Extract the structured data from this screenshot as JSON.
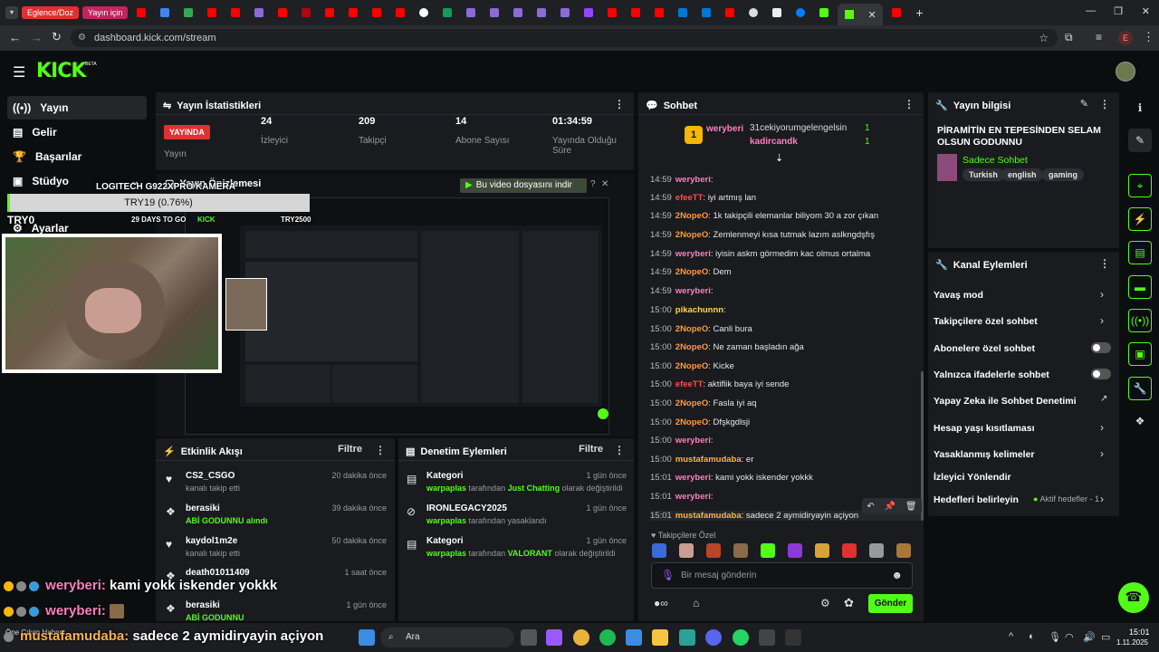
{
  "browser": {
    "tab_chip1": "Eglence/Doz",
    "tab_chip2": "Yayın için",
    "url": "dashboard.kick.com/stream"
  },
  "nav": {
    "items": [
      "Yayın",
      "Gelir",
      "Başarılar",
      "Stüdyo",
      "Ayarlar"
    ]
  },
  "overlay": {
    "camera": "LOGITECH G922XPRO KAMERA",
    "goal": "TRY19 (0.76%)",
    "try_left": "TRY0",
    "days": "29 DAYS TO GO",
    "kick": "KICK",
    "try_right": "TRY2500",
    "chat1_name": "weryberi:",
    "chat1_msg": "kami yokk iskender yokkk",
    "chat2_name": "weryberi:",
    "chat3_name": "mustafamudaba:",
    "chat3_msg": "sadece 2 aymidiryayin açiyon",
    "notice": "Öne Çıkan Haber"
  },
  "stats": {
    "title": "Yayın İstatistikleri",
    "live_badge": "YAYINDA",
    "live_label": "Yayın",
    "viewers": "24",
    "viewers_label": "İzleyici",
    "followers": "209",
    "followers_label": "Takipçi",
    "subs": "14",
    "subs_label": "Abone Sayısı",
    "uptime": "01:34:59",
    "uptime_label": "Yayında Olduğu Süre"
  },
  "preview": {
    "title": "Yayın Önizlemesi",
    "tooltip": "Bu video dosyasını indir"
  },
  "activity": {
    "title": "Etkinlik Akışı",
    "filter": "Filtre",
    "items": [
      {
        "name": "CS2_CSGO",
        "sub": "kanalı takip etti",
        "time": "20 dakika önce"
      },
      {
        "name": "berasiki",
        "sub": "ABİ GODUNNU alındı",
        "time": "39 dakika önce"
      },
      {
        "name": "kaydol1m2e",
        "sub": "kanalı takip etti",
        "time": "50 dakika önce"
      },
      {
        "name": "death01011409",
        "sub": "",
        "time": "1 saat önce"
      },
      {
        "name": "berasiki",
        "sub": "ABİ GODUNNU",
        "time": "1 gün önce"
      }
    ]
  },
  "moderation": {
    "title": "Denetim Eylemleri",
    "filter": "Filtre",
    "items": [
      {
        "name": "Kategori",
        "user": "warpaplas",
        "mid": "tarafından",
        "val": "Just Chatting",
        "end": "olarak değiştirildi",
        "time": "1 gün önce"
      },
      {
        "name": "IRONLEGACY2025",
        "user": "warpaplas",
        "mid": "tarafından yasaklandı",
        "val": "",
        "end": "",
        "time": "1 gün önce"
      },
      {
        "name": "Kategori",
        "user": "warpaplas",
        "mid": "tarafından",
        "val": "VALORANT",
        "end": "olarak değiştirildi",
        "time": "1 gün önce"
      }
    ]
  },
  "chat": {
    "title": "Sohbet",
    "top_gifter": "weryberi",
    "gifter_count": "1",
    "g2": "31cekiyorumgelengelsin",
    "g2_count": "1",
    "g3": "kadircandk",
    "g3_count": "1",
    "lines": [
      {
        "t": "14:59",
        "u": "weryberi",
        "m": "",
        "c": "#ff7fbf"
      },
      {
        "t": "14:59",
        "u": "efeeTT",
        "m": "iyi artmış lan",
        "c": "#ff4d4d"
      },
      {
        "t": "14:59",
        "u": "2NopeO",
        "m": "1k takipçili elemanlar biliyom 30 a zor çıkan",
        "c": "#ff9b3d"
      },
      {
        "t": "14:59",
        "u": "2NopeO",
        "m": "Zemlenmeyi kısa tutmak lazım aslkngdşfış",
        "c": "#ff9b3d"
      },
      {
        "t": "14:59",
        "u": "weryberi",
        "m": "iyisin askm görmedim kac olmus ortalma",
        "c": "#ff7fbf"
      },
      {
        "t": "14:59",
        "u": "2NopeO",
        "m": "Dem",
        "c": "#ff9b3d"
      },
      {
        "t": "14:59",
        "u": "weryberi",
        "m": "",
        "c": "#ff7fbf"
      },
      {
        "t": "15:00",
        "u": "pikachunnn",
        "m": "",
        "c": "#ffd54a"
      },
      {
        "t": "15:00",
        "u": "2NopeO",
        "m": "Canli bura",
        "c": "#ff9b3d"
      },
      {
        "t": "15:00",
        "u": "2NopeO",
        "m": "Ne zaman başladın ağa",
        "c": "#ff9b3d"
      },
      {
        "t": "15:00",
        "u": "2NopeO",
        "m": "Kicke",
        "c": "#ff9b3d"
      },
      {
        "t": "15:00",
        "u": "efeeTT",
        "m": "aktiflik baya iyi sende",
        "c": "#ff4d4d"
      },
      {
        "t": "15:00",
        "u": "2NopeO",
        "m": "Fasla iyi aq",
        "c": "#ff9b3d"
      },
      {
        "t": "15:00",
        "u": "2NopeO",
        "m": "Dfşkgdlsji",
        "c": "#ff9b3d"
      },
      {
        "t": "15:00",
        "u": "weryberi",
        "m": "",
        "c": "#ff7fbf"
      },
      {
        "t": "15:00",
        "u": "mustafamudaba",
        "m": "er",
        "c": "#ffb347"
      },
      {
        "t": "15:01",
        "u": "weryberi",
        "m": "kami yokk iskender yokkk",
        "c": "#ff7fbf"
      },
      {
        "t": "15:01",
        "u": "weryberi",
        "m": "",
        "c": "#ff7fbf"
      },
      {
        "t": "15:01",
        "u": "mustafamudaba",
        "m": "sadece 2 aymidiryayin açiyon",
        "c": "#ffb347"
      }
    ],
    "emote_label": "Takipçilere Özel",
    "input_placeholder": "Bir mesaj gönderin",
    "send": "Gönder"
  },
  "info": {
    "title": "Yayın bilgisi",
    "stream_title": "PİRAMİTİN EN TEPESİNDEN SELAM OLSUN GODUNNU",
    "category": "Sadece Sohbet",
    "tags": [
      "Turkish",
      "english",
      "gaming"
    ]
  },
  "channel": {
    "title": "Kanal Eylemleri",
    "actions": [
      "Yavaş mod",
      "Takipçilere özel sohbet",
      "Abonelere özel sohbet",
      "Yalnızca ifadelerle sohbet",
      "Yapay Zeka ile Sohbet Denetimi",
      "Hesap yaşı kısıtlaması",
      "Yasaklanmış kelimeler",
      "İzleyici Yönlendir",
      "Hedefleri belirleyin"
    ],
    "goals_active": "Aktif hedefler - 1"
  },
  "taskbar": {
    "search": "Ara",
    "time": "15:01",
    "date": "1.11.2025"
  },
  "colors": {
    "accent": "#53fc18",
    "panel": "#191b1f",
    "bg": "#0b0e0f"
  }
}
